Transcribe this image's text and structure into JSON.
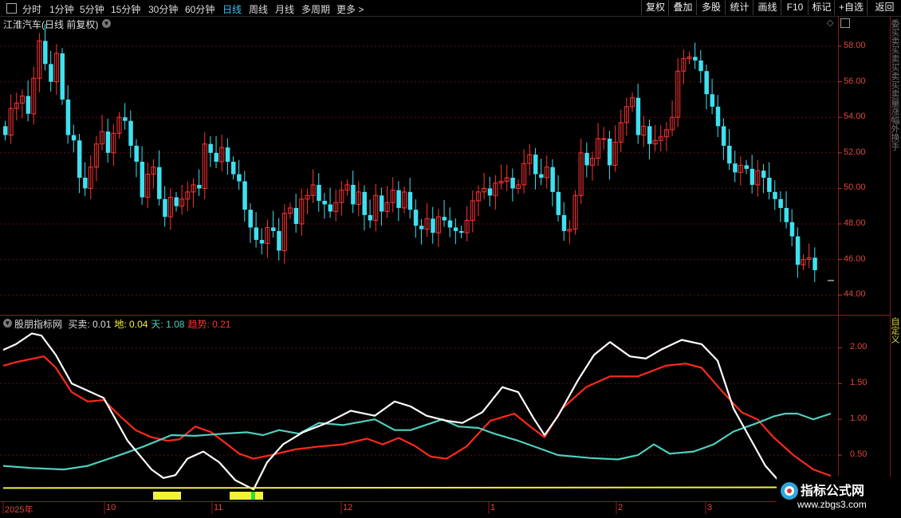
{
  "toolbar": {
    "periods": [
      "分时",
      "1分钟",
      "5分钟",
      "15分钟",
      "30分钟",
      "60分钟",
      "日线",
      "周线",
      "月线",
      "多周期",
      "更多 >"
    ],
    "active_period": "日线",
    "tools": [
      "复权",
      "叠加",
      "多股",
      "统计",
      "画线",
      "F10",
      "标记",
      "+自选",
      "返回"
    ]
  },
  "stock": {
    "title": "江淮汽车(日线 前复权)"
  },
  "price_axis": [
    "58.00",
    "56.00",
    "54.00",
    "52.00",
    "50.00",
    "48.00",
    "46.00",
    "44.00"
  ],
  "indicator": {
    "name": "股朋指标网",
    "items": [
      {
        "label": "买卖:",
        "value": "0.01",
        "color": "#dddddd"
      },
      {
        "label": "地:",
        "value": "0.04",
        "color": "#f2f23a"
      },
      {
        "label": "天:",
        "value": "1.08",
        "color": "#4fcfbf"
      },
      {
        "label": "趋势:",
        "value": "0.21",
        "color": "#ff3030"
      }
    ],
    "axis": [
      "2.00",
      "1.50",
      "1.00",
      "0.50"
    ]
  },
  "x_axis": [
    "2025年",
    "10",
    "11",
    "12",
    "1",
    "2",
    "3"
  ],
  "side": {
    "top": "委买卖买卖买卖买卖量涨幅外换手",
    "bottom": "自定义"
  },
  "watermark": {
    "title": "指标公式网",
    "url": "www.zbgs3.com"
  },
  "colors": {
    "up": "#ff3333",
    "down": "#3fe0f0",
    "white": "#ffffff",
    "red": "#ff2a1a",
    "cyan": "#4fcfbf",
    "yellow": "#f2f23a"
  }
}
